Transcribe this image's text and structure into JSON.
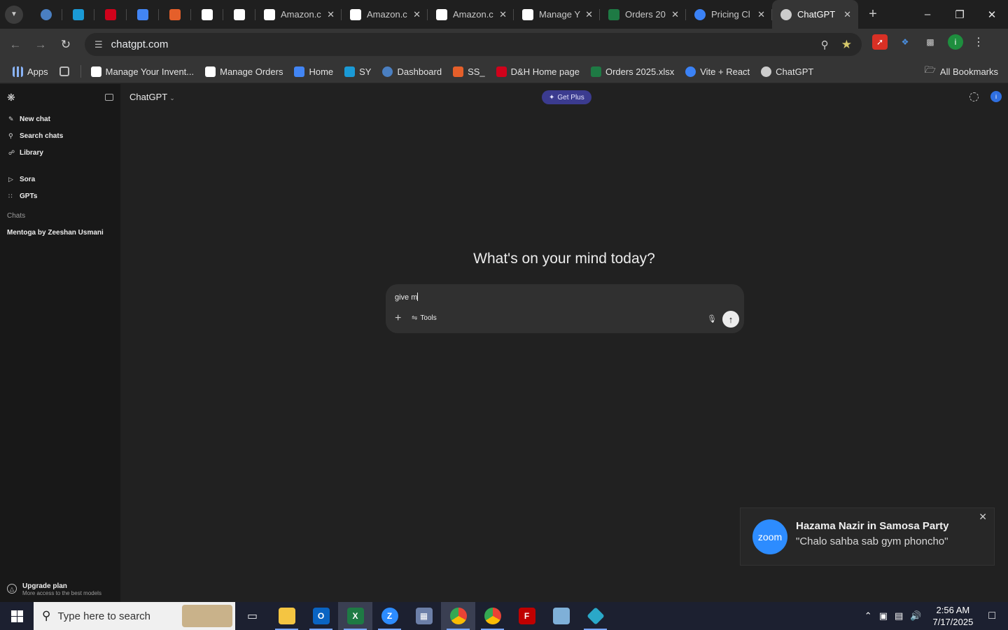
{
  "browser": {
    "pinned_tabs": [
      {
        "icon": "dashboard-icon",
        "color": "#4a7fc1"
      },
      {
        "icon": "ec-icon",
        "color": "#1a9ad6"
      },
      {
        "icon": "dh-icon",
        "color": "#d0021b"
      },
      {
        "icon": "docs-icon",
        "color": "#4285f4"
      },
      {
        "icon": "ss-icon",
        "color": "#e55f2a"
      },
      {
        "icon": "amazon-icon",
        "color": "#ffffff"
      },
      {
        "icon": "amazon-icon",
        "color": "#ffffff"
      }
    ],
    "tabs": [
      {
        "title": "Amazon.c",
        "icon": "amazon-icon",
        "color": "#ffffff",
        "active": false
      },
      {
        "title": "Amazon.c",
        "icon": "amazon-icon",
        "color": "#ffffff",
        "active": false
      },
      {
        "title": "Amazon.c",
        "icon": "amazon-icon",
        "color": "#ffffff",
        "active": false
      },
      {
        "title": "Manage Y",
        "icon": "amazon-icon",
        "color": "#ffffff",
        "active": false
      },
      {
        "title": "Orders 20",
        "icon": "excel-icon",
        "color": "#1e7a44",
        "active": false
      },
      {
        "title": "Pricing Cl",
        "icon": "pricing-icon",
        "color": "#3b82f6",
        "active": false
      },
      {
        "title": "ChatGPT",
        "icon": "chatgpt-icon",
        "color": "#cccccc",
        "active": true
      }
    ],
    "url": "chatgpt.com",
    "bookmarks": [
      {
        "label": "Apps",
        "icon": "apps-grid-icon"
      },
      {
        "label": "Manage Your Invent...",
        "icon": "amazon-icon"
      },
      {
        "label": "Manage Orders",
        "icon": "amazon-icon"
      },
      {
        "label": "Home",
        "icon": "docs-icon"
      },
      {
        "label": "SY",
        "icon": "ec-icon"
      },
      {
        "label": "Dashboard",
        "icon": "dashboard-icon"
      },
      {
        "label": "SS_",
        "icon": "ss-icon"
      },
      {
        "label": "D&H Home page",
        "icon": "dh-icon"
      },
      {
        "label": "Orders 2025.xlsx",
        "icon": "excel-icon"
      },
      {
        "label": "Vite + React",
        "icon": "pricing-icon"
      },
      {
        "label": "ChatGPT",
        "icon": "chatgpt-icon"
      }
    ],
    "all_bookmarks": "All Bookmarks",
    "profile_initial": "i"
  },
  "sidebar": {
    "items": [
      {
        "label": "New chat",
        "icon": "edit-icon"
      },
      {
        "label": "Search chats",
        "icon": "search-icon"
      },
      {
        "label": "Library",
        "icon": "library-icon"
      }
    ],
    "items2": [
      {
        "label": "Sora",
        "icon": "play-icon"
      },
      {
        "label": "GPTs",
        "icon": "grid-icon"
      }
    ],
    "chats_heading": "Chats",
    "chats": [
      "Mentoga by Zeeshan Usmani"
    ],
    "upgrade_title": "Upgrade plan",
    "upgrade_sub": "More access to the best models"
  },
  "main": {
    "model": "ChatGPT",
    "get_plus": "Get Plus",
    "avatar_initial": "i",
    "headline": "What's on your mind today?",
    "composer_text": "give m",
    "tools_label": "Tools"
  },
  "toast": {
    "logo": "zoom",
    "title": "Hazama Nazir in Samosa Party",
    "message": "\"Chalo sahba sab gym phoncho\""
  },
  "taskbar": {
    "search_placeholder": "Type here to search",
    "time": "2:56 AM",
    "date": "7/17/2025"
  }
}
